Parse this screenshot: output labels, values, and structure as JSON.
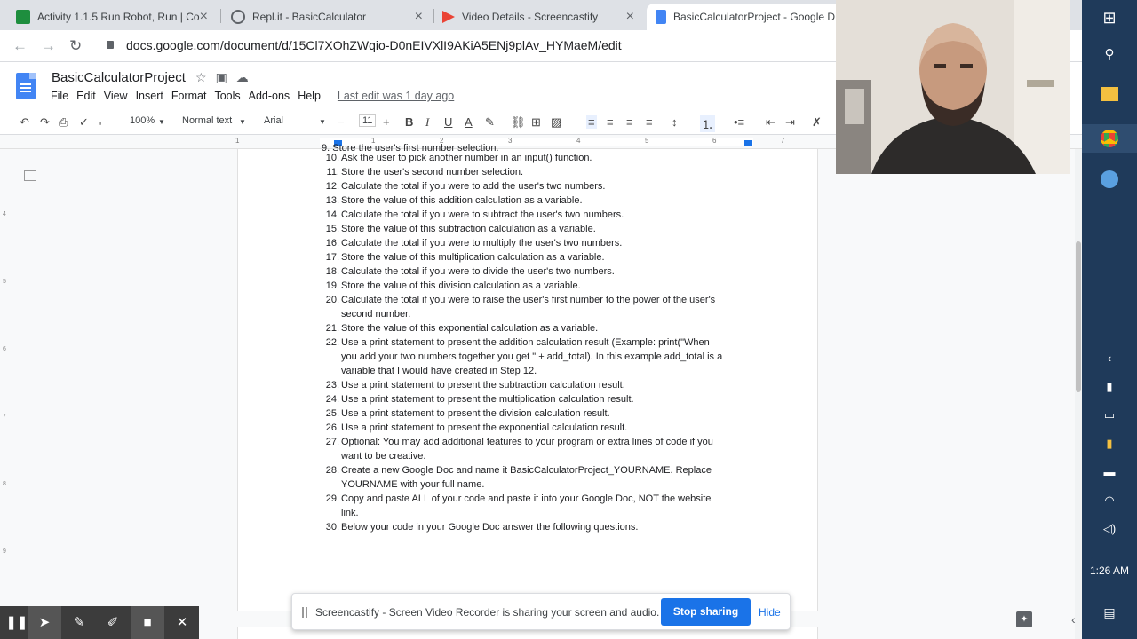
{
  "browser": {
    "tabs": [
      {
        "title": "Activity 1.1.5 Run Robot, Run | Co",
        "icon": "classroom-icon",
        "color": "#1e8e3e"
      },
      {
        "title": "Repl.it - BasicCalculator",
        "icon": "replit-icon",
        "color": "#5f6368"
      },
      {
        "title": "Video Details - Screencastify",
        "icon": "screencastify-icon",
        "color": "#ea4335"
      },
      {
        "title": "BasicCalculatorProject - Google D",
        "icon": "docs-icon",
        "color": "#4285f4"
      }
    ],
    "url": "docs.google.com/document/d/15Cl7XOhZWqio-D0nEIVXlI9AKiA5ENj9plAv_HYMaeM/edit"
  },
  "docs": {
    "title": "BasicCalculatorProject",
    "menu": [
      "File",
      "Edit",
      "View",
      "Insert",
      "Format",
      "Tools",
      "Add-ons",
      "Help"
    ],
    "last_edit": "Last edit was 1 day ago",
    "toolbar": {
      "zoom": "100%",
      "style": "Normal text",
      "font": "Arial",
      "font_size": "11"
    },
    "ruler": [
      "1",
      "1",
      "2",
      "3",
      "4",
      "5",
      "6",
      "7"
    ]
  },
  "document": {
    "cut_line": "9.  Store the user's first number selection.",
    "items": [
      {
        "num": "10.",
        "lines": [
          "Ask the user to pick another number in an input() function."
        ]
      },
      {
        "num": "11.",
        "lines": [
          "Store the user's second number selection."
        ]
      },
      {
        "num": "12.",
        "lines": [
          "Calculate the total if you were to add the user's two numbers."
        ]
      },
      {
        "num": "13.",
        "lines": [
          "Store the value of this addition calculation as a variable."
        ]
      },
      {
        "num": "14.",
        "lines": [
          "Calculate the total if you were to subtract the user's two numbers."
        ]
      },
      {
        "num": "15.",
        "lines": [
          "Store the value of this subtraction calculation as a variable."
        ]
      },
      {
        "num": "16.",
        "lines": [
          "Calculate the total if you were to multiply the user's two numbers."
        ]
      },
      {
        "num": "17.",
        "lines": [
          "Store the value of this multiplication calculation as a variable."
        ]
      },
      {
        "num": "18.",
        "lines": [
          "Calculate the total if you were to divide the user's two numbers."
        ]
      },
      {
        "num": "19.",
        "lines": [
          "Store the value of this division calculation as a variable."
        ]
      },
      {
        "num": "20.",
        "lines": [
          "Calculate the total if you were to raise the user's first number to the power of the user's",
          "second number."
        ]
      },
      {
        "num": "21.",
        "lines": [
          "Store the value of this exponential calculation as a variable."
        ]
      },
      {
        "num": "22.",
        "lines": [
          "Use a print statement to present the addition calculation result (Example: print(\"When",
          "you add your two numbers together you get \" + add_total). In this example add_total is a",
          "variable that I would have created in Step 12."
        ]
      },
      {
        "num": "23.",
        "lines": [
          "Use a print statement to present the subtraction calculation result."
        ]
      },
      {
        "num": "24.",
        "lines": [
          "Use a print statement to present the multiplication calculation result."
        ]
      },
      {
        "num": "25.",
        "lines": [
          "Use a print statement to present the division calculation result."
        ]
      },
      {
        "num": "26.",
        "lines": [
          "Use a print statement to present the exponential calculation result."
        ]
      },
      {
        "num": "27.",
        "lines": [
          "Optional: You may add additional features to your program or extra lines of code if you",
          "want to be creative."
        ]
      },
      {
        "num": "28.",
        "lines": [
          "Create a new Google Doc and name it BasicCalculatorProject_YOURNAME. Replace",
          "YOURNAME with your full name."
        ]
      },
      {
        "num": "29.",
        "lines": [
          "Copy and paste ALL of your code and paste it into your Google Doc, NOT the website",
          "link."
        ]
      },
      {
        "num": "30.",
        "lines": [
          "Below your code in your Google Doc answer the following questions."
        ]
      }
    ]
  },
  "screencastify": {
    "message": "Screencastify - Screen Video Recorder is sharing your screen and audio.",
    "stop_label": "Stop sharing",
    "hide_label": "Hide"
  },
  "system": {
    "time": "1:26 AM",
    "taskbar_icons": [
      "windows-icon",
      "search-icon",
      "file-explorer-icon",
      "chrome-icon",
      "app-icon"
    ],
    "tray_icons": [
      "chevron-left-icon",
      "usb-icon",
      "display-icon",
      "security-icon",
      "battery-icon",
      "wifi-icon",
      "volume-icon"
    ]
  }
}
